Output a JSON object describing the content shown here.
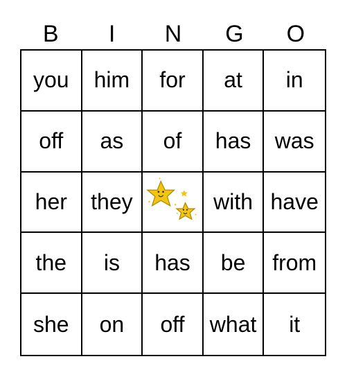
{
  "header": [
    "B",
    "I",
    "N",
    "G",
    "O"
  ],
  "rows": [
    [
      "you",
      "him",
      "for",
      "at",
      "in"
    ],
    [
      "off",
      "as",
      "of",
      "has",
      "was"
    ],
    [
      "her",
      "they",
      "",
      "with",
      "have"
    ],
    [
      "the",
      "is",
      "has",
      "be",
      "from"
    ],
    [
      "she",
      "on",
      "off",
      "what",
      "it"
    ]
  ],
  "free_space": {
    "icon": "smiling-stars-icon",
    "position": [
      2,
      2
    ]
  },
  "colors": {
    "star": "#f2c512",
    "star_outline": "#b08a00",
    "line": "#000000"
  }
}
